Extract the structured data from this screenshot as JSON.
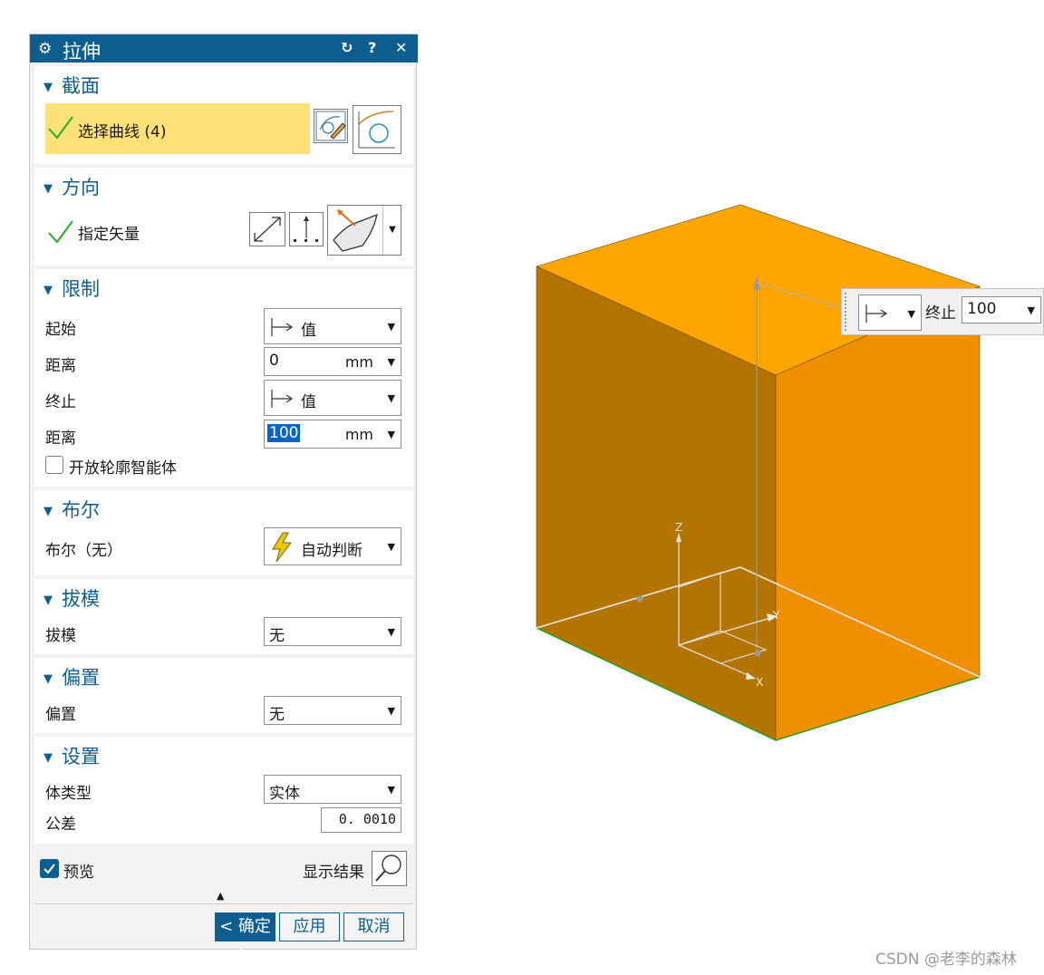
{
  "dialog": {
    "title": "拉伸",
    "title_icon": "gear-icon"
  },
  "section_title": {
    "heading": "截面",
    "select_curve_label": "选择曲线 (4)"
  },
  "direction": {
    "heading": "方向",
    "vector_label": "指定矢量"
  },
  "limits": {
    "heading": "限制",
    "start_label": "起始",
    "start_value": "值",
    "start_distance_label": "距离",
    "start_distance": "0",
    "start_unit": "mm",
    "end_label": "终止",
    "end_value": "值",
    "end_distance_label": "距离",
    "end_distance": "100",
    "end_unit": "mm",
    "open_profile_label": "开放轮廓智能体"
  },
  "boolean": {
    "heading": "布尔",
    "label": "布尔（无）",
    "value": "自动判断"
  },
  "draft": {
    "heading": "拔模",
    "label": "拔模",
    "value": "无"
  },
  "offset": {
    "heading": "偏置",
    "label": "偏置",
    "value": "无"
  },
  "settings": {
    "heading": "设置",
    "body_type_label": "体类型",
    "body_type_value": "实体",
    "tolerance_label": "公差",
    "tolerance_value": "0. 0010"
  },
  "footer": {
    "preview_label": "预览",
    "show_result_label": "显示结果",
    "ok_label": "< 确定 >",
    "apply_label": "应用",
    "cancel_label": "取消"
  },
  "popup": {
    "end_label": "终止",
    "end_value": "100"
  },
  "axes": {
    "z": "Z",
    "y": "Y",
    "x": "X"
  },
  "watermark": "CSDN @老李的森林",
  "colors": {
    "title_bar": "#0e5f8f",
    "selection_highlight": "#ffe17a",
    "check_green": "#22b022",
    "box_top": "#ffa500",
    "box_left": "#b37400",
    "box_right": "#f09000"
  }
}
